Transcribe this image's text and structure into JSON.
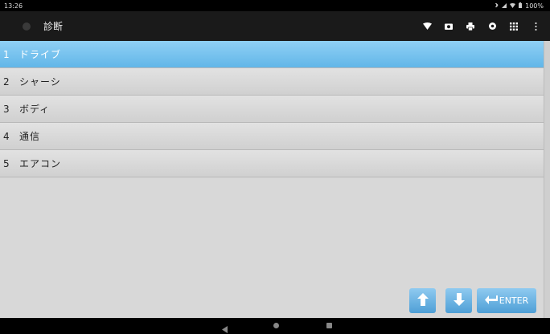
{
  "status_bar": {
    "time": "13:26",
    "battery": "100%",
    "icons": [
      "bluetooth-icon",
      "signal-icon",
      "wifi-icon",
      "battery-icon"
    ]
  },
  "header": {
    "title": "診断",
    "icons": [
      "wifi-icon",
      "camera-icon",
      "print-icon",
      "record-icon",
      "grid-icon",
      "more-vert-icon"
    ]
  },
  "menu": {
    "items": [
      {
        "number": "1",
        "label": "ドライブ",
        "selected": true
      },
      {
        "number": "2",
        "label": "シャーシ",
        "selected": false
      },
      {
        "number": "3",
        "label": "ボディ",
        "selected": false
      },
      {
        "number": "4",
        "label": "通信",
        "selected": false
      },
      {
        "number": "5",
        "label": "エアコン",
        "selected": false
      }
    ]
  },
  "controls": {
    "up": "up-arrow-icon",
    "down": "down-arrow-icon",
    "enter_label": "ENTER"
  },
  "nav_bar": {
    "icons": [
      "back-icon",
      "home-icon",
      "recent-apps-icon"
    ]
  },
  "colors": {
    "selected": "#62b6e8",
    "background": "#d8d8d8",
    "header": "#1a1a1a"
  }
}
